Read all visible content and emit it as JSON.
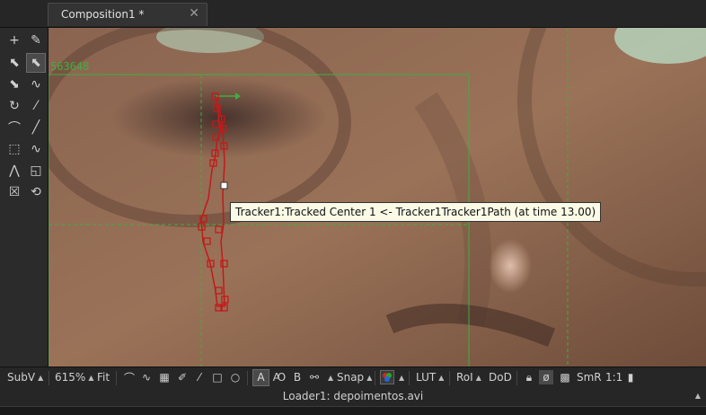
{
  "tab": {
    "title": "Composition1 *",
    "close_glyph": "✕"
  },
  "viewer": {
    "coord_readout": "563648",
    "tooltip": "Tracker1:Tracked Center 1 <- Tracker1Tracker1Path (at time 13.00)"
  },
  "left_toolbar": {
    "icons": [
      "add-point-icon",
      "pen-draw-icon",
      "select-add-icon",
      "select-arrow-icon",
      "delete-point-icon",
      "smooth-spline-icon",
      "rotate-icon",
      "magic-wand-icon",
      "bezier-icon",
      "line-icon",
      "rect-select-icon",
      "bspline-icon",
      "polyline-icon",
      "transform-box-icon",
      "close-shape-icon",
      "reverse-icon"
    ]
  },
  "bottom_toolbar": {
    "subview": "SubV",
    "zoom": "615%",
    "fit": "Fit",
    "a_label": "A",
    "snap": "Snap",
    "lut": "LUT",
    "roi": "RoI",
    "dod": "DoD",
    "smr": "SmR",
    "ratio": "1:1"
  },
  "status": {
    "text": "Loader1: depoimentos.avi"
  },
  "colors": {
    "accent_green": "#3fae3f",
    "track_red": "#c21a1a",
    "tooltip_bg": "#fafae6"
  }
}
